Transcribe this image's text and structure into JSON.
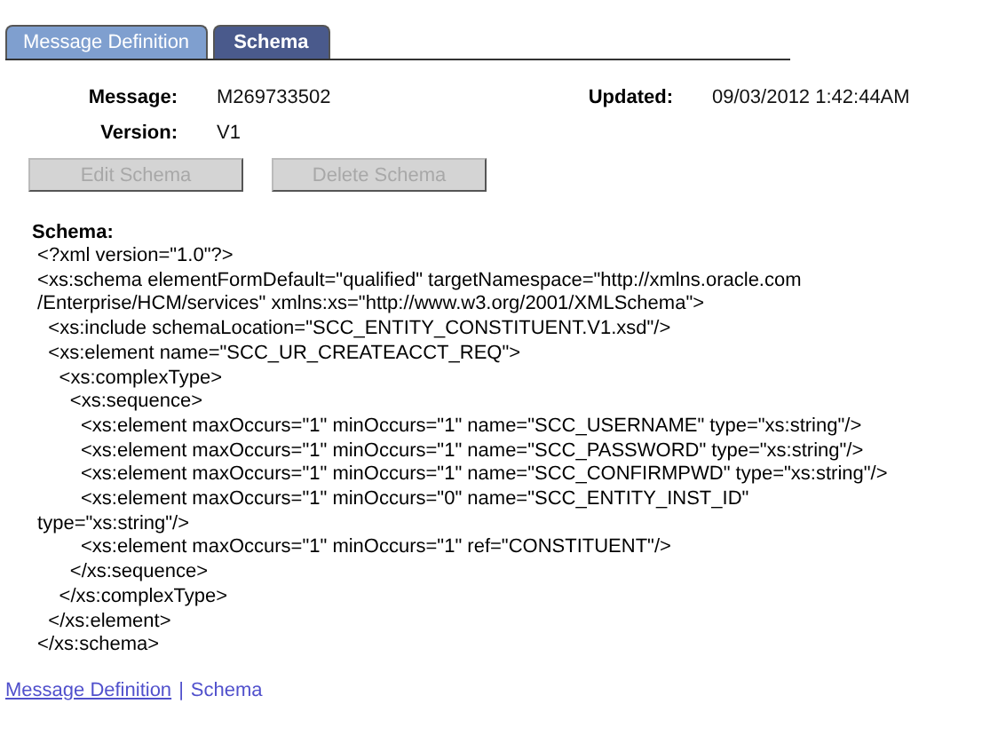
{
  "tabs": [
    {
      "label": "Message Definition",
      "selected": false
    },
    {
      "label": "Schema",
      "selected": true
    }
  ],
  "fields": [
    {
      "label": "Message:",
      "value": "M269733502"
    },
    {
      "label": "Updated:",
      "value": "09/03/2012  1:42:44AM"
    },
    {
      "label": "Version:",
      "value": "V1"
    }
  ],
  "buttons": [
    {
      "label": "Edit Schema",
      "disabled": true
    },
    {
      "label": "Delete Schema",
      "disabled": true
    }
  ],
  "schema": {
    "label": "Schema:",
    "text": " <?xml version=\"1.0\"?>\n <xs:schema elementFormDefault=\"qualified\" targetNamespace=\"http://xmlns.oracle.com\n /Enterprise/HCM/services\" xmlns:xs=\"http://www.w3.org/2001/XMLSchema\">\n   <xs:include schemaLocation=\"SCC_ENTITY_CONSTITUENT.V1.xsd\"/>\n   <xs:element name=\"SCC_UR_CREATEACCT_REQ\">\n     <xs:complexType>\n       <xs:sequence>\n         <xs:element maxOccurs=\"1\" minOccurs=\"1\" name=\"SCC_USERNAME\" type=\"xs:string\"/>\n         <xs:element maxOccurs=\"1\" minOccurs=\"1\" name=\"SCC_PASSWORD\" type=\"xs:string\"/>\n         <xs:element maxOccurs=\"1\" minOccurs=\"1\" name=\"SCC_CONFIRMPWD\" type=\"xs:string\"/>\n         <xs:element maxOccurs=\"1\" minOccurs=\"0\" name=\"SCC_ENTITY_INST_ID\"\n type=\"xs:string\"/>\n         <xs:element maxOccurs=\"1\" minOccurs=\"1\" ref=\"CONSTITUENT\"/>\n       </xs:sequence>\n     </xs:complexType>\n   </xs:element>\n </xs:schema>"
  },
  "footer_links": [
    {
      "label": "Message Definition",
      "kind": "link"
    },
    {
      "label": "|",
      "kind": "separator"
    },
    {
      "label": "Schema",
      "kind": "link"
    }
  ]
}
